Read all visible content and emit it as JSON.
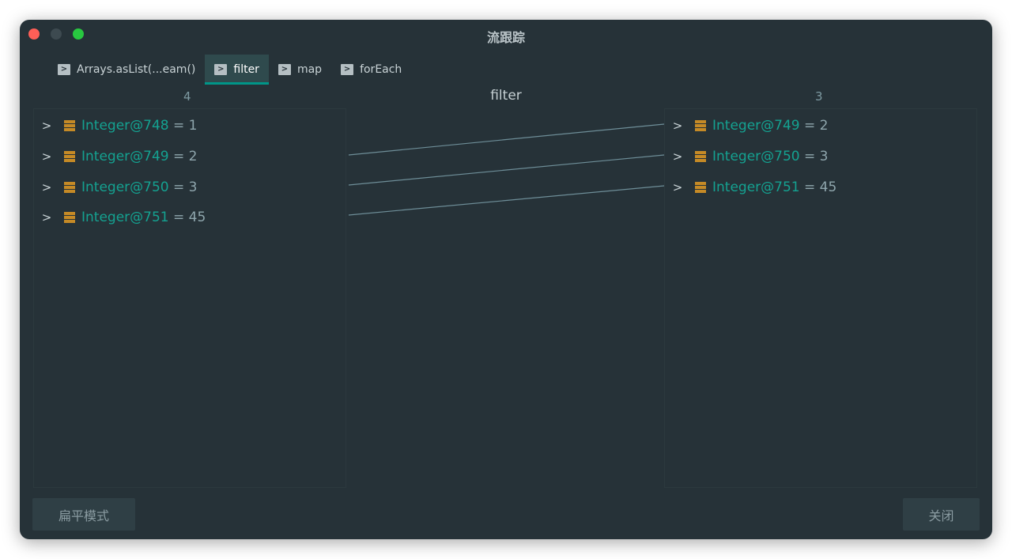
{
  "window": {
    "title": "流跟踪"
  },
  "tabs": [
    {
      "label": "Arrays.asList(...eam()",
      "icon": "play-icon",
      "active": false
    },
    {
      "label": "filter",
      "icon": "play-icon",
      "active": true
    },
    {
      "label": "map",
      "icon": "play-icon",
      "active": false
    },
    {
      "label": "forEach",
      "icon": "play-icon",
      "active": false
    }
  ],
  "stage": {
    "title": "filter",
    "left_count": "4",
    "right_count": "3"
  },
  "left_items": [
    {
      "name": "Integer@748",
      "value": " = 1"
    },
    {
      "name": "Integer@749",
      "value": " = 2"
    },
    {
      "name": "Integer@750",
      "value": " = 3"
    },
    {
      "name": "Integer@751",
      "value": " = 45"
    }
  ],
  "right_items": [
    {
      "name": "Integer@749",
      "value": " = 2"
    },
    {
      "name": "Integer@750",
      "value": " = 3"
    },
    {
      "name": "Integer@751",
      "value": " = 45"
    }
  ],
  "mappings": [
    {
      "from": "Integer@749",
      "to": "Integer@749"
    },
    {
      "from": "Integer@750",
      "to": "Integer@750"
    },
    {
      "from": "Integer@751",
      "to": "Integer@751"
    }
  ],
  "buttons": {
    "flat_mode": "扁平模式",
    "close": "关闭"
  },
  "colors": {
    "background": "#263238",
    "accent": "#009688",
    "item_name": "#14a291",
    "item_icon": "#c58a26",
    "link_line": "#6e8e98"
  }
}
